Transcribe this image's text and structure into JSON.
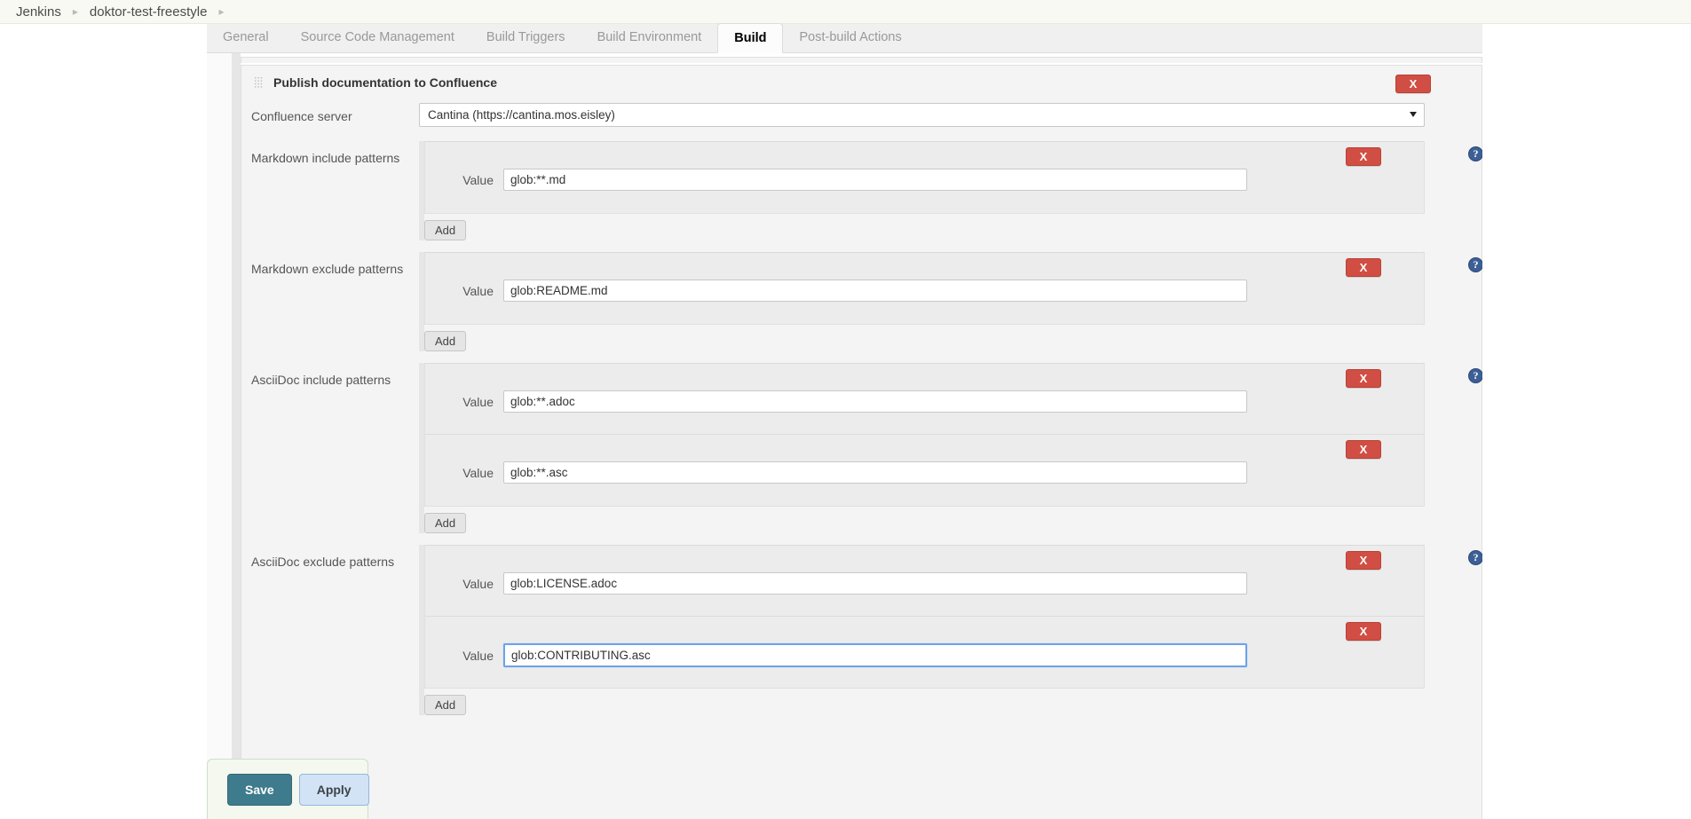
{
  "breadcrumb": {
    "items": [
      {
        "label": "Jenkins"
      },
      {
        "label": "doktor-test-freestyle"
      }
    ],
    "separator": "▸"
  },
  "tabs": [
    {
      "label": "General",
      "active": false
    },
    {
      "label": "Source Code Management",
      "active": false
    },
    {
      "label": "Build Triggers",
      "active": false
    },
    {
      "label": "Build Environment",
      "active": false
    },
    {
      "label": "Build",
      "active": true
    },
    {
      "label": "Post-build Actions",
      "active": false
    }
  ],
  "builder": {
    "title": "Publish documentation to Confluence",
    "delete_label": "X",
    "server_row": {
      "label": "Confluence server",
      "selected": "Cantina (https://cantina.mos.eisley)"
    },
    "sections": [
      {
        "label": "Markdown include patterns",
        "help_label": "?",
        "add_label": "Add",
        "items": [
          {
            "value_label": "Value",
            "value": "glob:**.md",
            "delete_label": "X",
            "focused": false
          }
        ]
      },
      {
        "label": "Markdown exclude patterns",
        "help_label": "?",
        "add_label": "Add",
        "items": [
          {
            "value_label": "Value",
            "value": "glob:README.md",
            "delete_label": "X",
            "focused": false
          }
        ]
      },
      {
        "label": "AsciiDoc include patterns",
        "help_label": "?",
        "add_label": "Add",
        "items": [
          {
            "value_label": "Value",
            "value": "glob:**.adoc",
            "delete_label": "X",
            "focused": false
          },
          {
            "value_label": "Value",
            "value": "glob:**.asc",
            "delete_label": "X",
            "focused": false
          }
        ]
      },
      {
        "label": "AsciiDoc exclude patterns",
        "help_label": "?",
        "add_label": "Add",
        "items": [
          {
            "value_label": "Value",
            "value": "glob:LICENSE.adoc",
            "delete_label": "X",
            "focused": false
          },
          {
            "value_label": "Value",
            "value": "glob:CONTRIBUTING.asc",
            "delete_label": "X",
            "focused": true
          }
        ]
      }
    ]
  },
  "footer": {
    "save_label": "Save",
    "apply_label": "Apply"
  },
  "colors": {
    "breadcrumb_bg": "#f7f9f2",
    "delete_red": "#d04e43",
    "help_blue": "#3c5f96",
    "save_teal": "#3e7b8c",
    "apply_blue": "#d2e3f5",
    "focus_blue": "#6aa3e8"
  }
}
